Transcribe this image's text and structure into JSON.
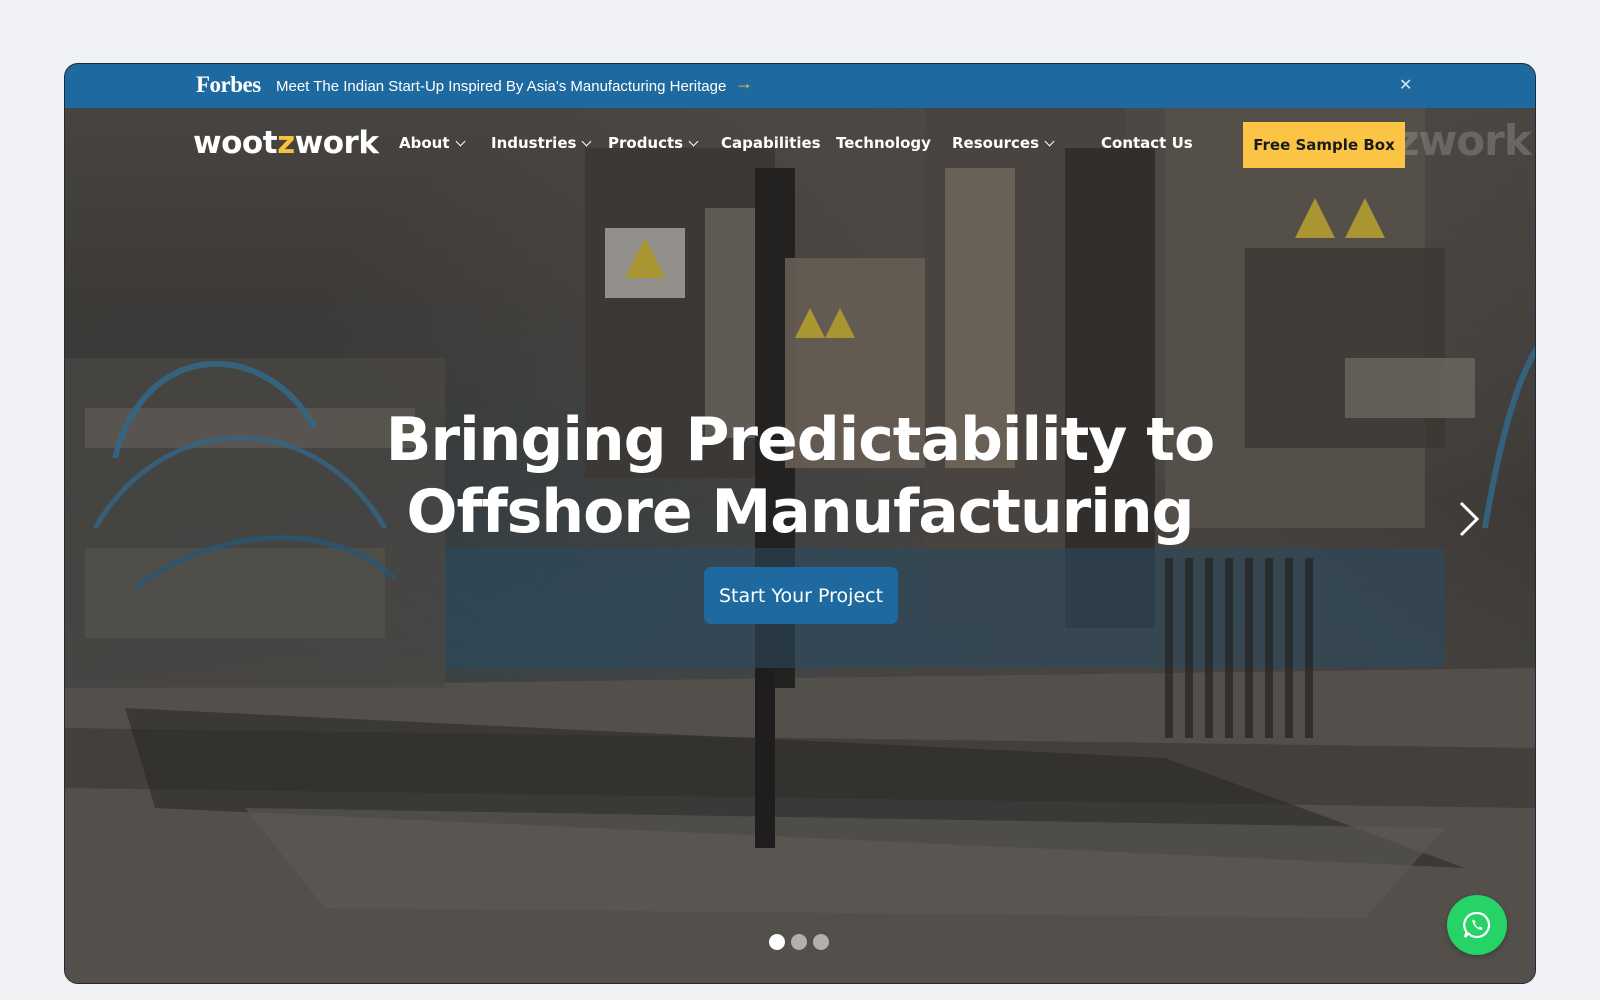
{
  "announcement": {
    "brand": "Forbes",
    "headline": "Meet The Indian Start-Up Inspired By Asia's Manufacturing Heritage",
    "arrow_icon": "arrow-right-icon",
    "close_icon": "close-icon"
  },
  "header": {
    "logo_pre": "woot",
    "logo_z": "z",
    "logo_post": "work",
    "logo_ghost": "zwork",
    "nav": [
      {
        "label": "About"
      },
      {
        "label": "Industries"
      },
      {
        "label": "Products"
      },
      {
        "label": "Capabilities"
      },
      {
        "label": "Technology"
      },
      {
        "label": "Resources"
      }
    ],
    "contact": "Contact Us",
    "cta": "Free Sample Box"
  },
  "hero": {
    "title_line1": "Bringing Predictability to",
    "title_line2": "Offshore Manufacturing",
    "cta": "Start Your Project",
    "slides_total": 3,
    "active_slide": 1,
    "next_icon": "chevron-right-icon"
  },
  "floating": {
    "icon": "whatsapp-icon"
  },
  "colors": {
    "page_bg": "#f0f2f6",
    "announcement_bg": "#1e6aa0",
    "accent_yellow": "#fbc445",
    "primary_blue": "#1e6aa0",
    "whatsapp_green": "#25d366"
  }
}
